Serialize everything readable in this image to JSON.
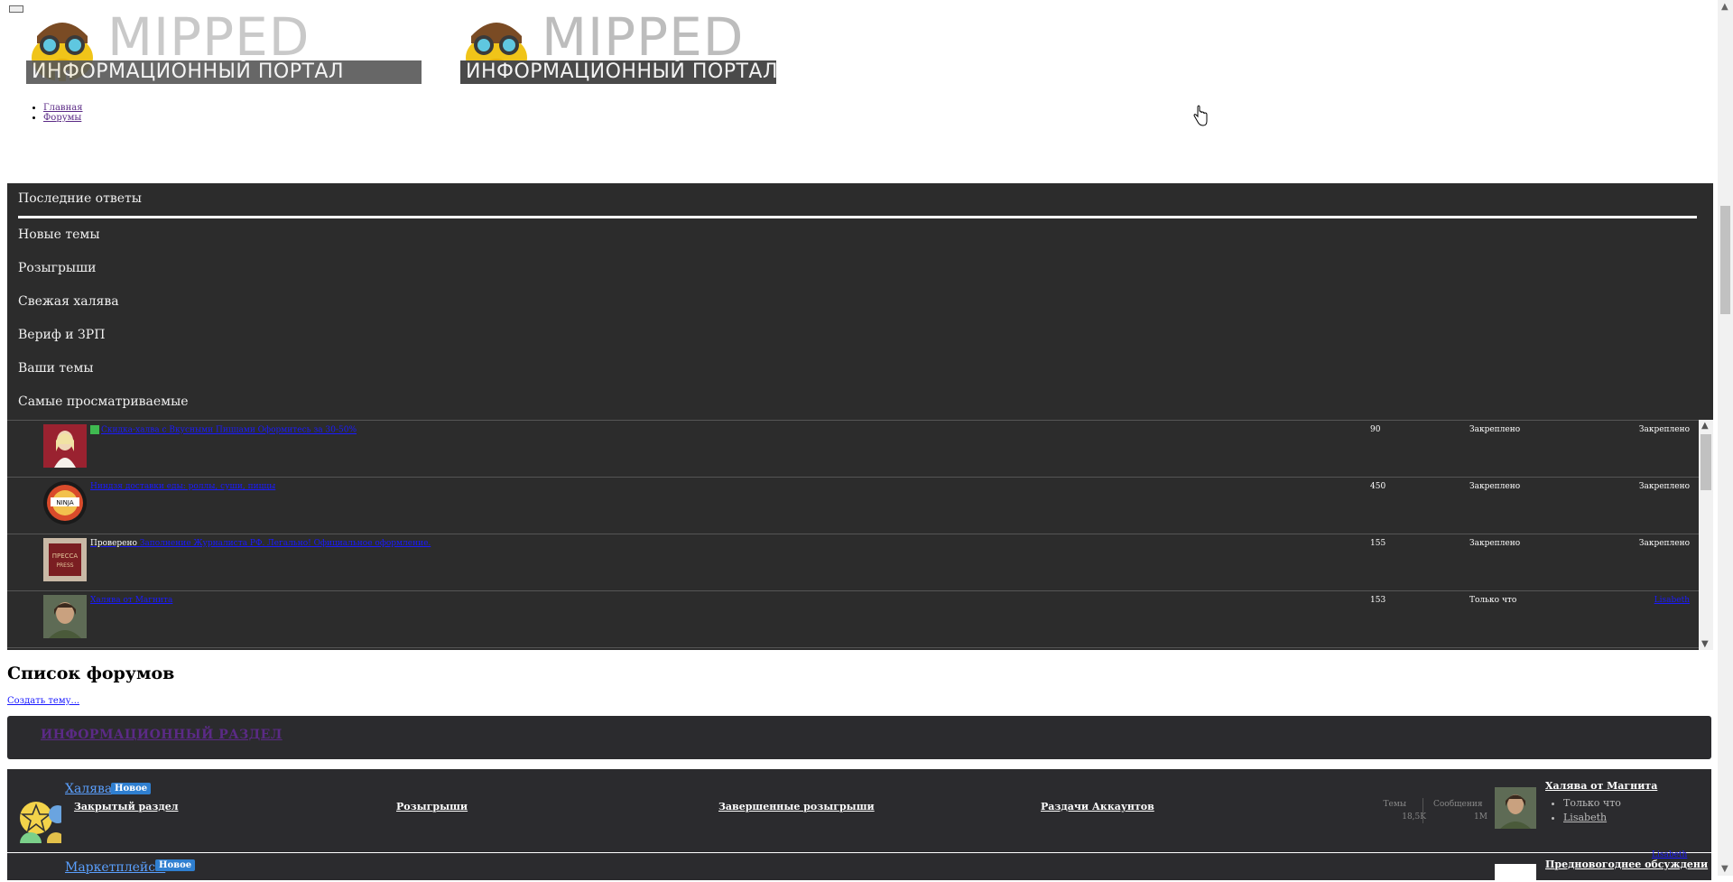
{
  "header": {
    "logo_word": "MIPPED",
    "logo_subtitle": "ИНФОРМАЦИОННЫЙ ПОРТАЛ"
  },
  "nav": {
    "items": [
      {
        "label": "Главная"
      },
      {
        "label": "Форумы"
      }
    ]
  },
  "tabs": [
    {
      "label": "Последние ответы"
    },
    {
      "label": "Новые темы"
    },
    {
      "label": "Розыгрыши"
    },
    {
      "label": "Свежая халява"
    },
    {
      "label": "Вериф и ЗРП"
    },
    {
      "label": "Ваши темы"
    },
    {
      "label": "Самые просматриваемые"
    }
  ],
  "threads": [
    {
      "prefix": "",
      "title": "Скидка-халва с Вкусными Пиццами Оформитесь за 30-50%",
      "count": "90",
      "status": "Закреплено",
      "last": "Закреплено"
    },
    {
      "prefix": "",
      "title": "Ниндзя доставки еды: роллы, суши, пиццы",
      "count": "450",
      "status": "Закреплено",
      "last": "Закреплено"
    },
    {
      "prefix": "Проверено",
      "title": "Заполнение Журналиста РФ. Легально! Официальное оформление.",
      "count": "155",
      "status": "Закреплено",
      "last": "Закреплено"
    },
    {
      "prefix": "",
      "title": "Халява от Магнита",
      "count": "153",
      "status": "Только что",
      "last": "Lisabeth"
    }
  ],
  "forum_list": {
    "title": "Список форумов",
    "create_link": "Создать тему...",
    "category_title": "ИНФОРМАЦИОННЫЙ РАЗДЕЛ",
    "category_icon": "",
    "nodes": [
      {
        "title": "Халява",
        "badge": "Новое",
        "subforums": [
          "Закрытый раздел",
          "Розыгрыши",
          "Завершенные розыгрыши",
          "Раздачи Аккаунтов"
        ],
        "threads_label": "Темы",
        "threads_value": "18,5K",
        "posts_label": "Сообщения",
        "posts_value": "1M",
        "latest_title": "Халява от Магнита",
        "latest_time": "Только что",
        "latest_user": "Lisabeth"
      },
      {
        "title": "Маркетплейсы",
        "badge": "Новое",
        "latest_title": "Предновогоднее обсуждени"
      }
    ]
  },
  "bottom_link": "Lisabeth",
  "icons": {
    "subforum_icon": "",
    "mascot": "walrus-aviator-mascot-icon",
    "star": "star-icon"
  }
}
